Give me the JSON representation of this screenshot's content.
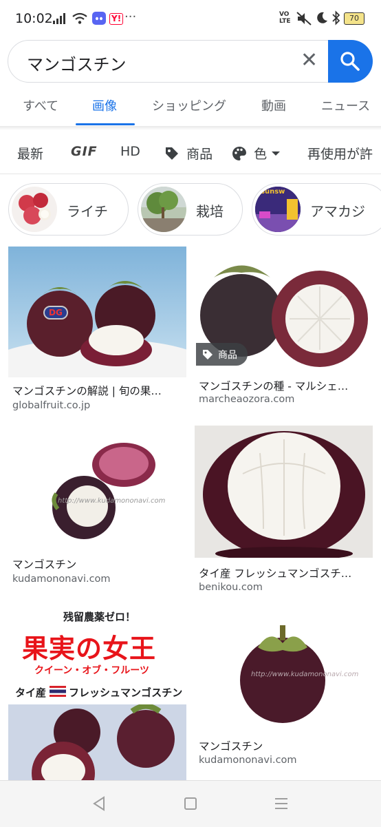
{
  "status_bar": {
    "time": "10:02",
    "signal_label": "Y!",
    "more": "···",
    "volte": "VO LTE",
    "battery": "70"
  },
  "search": {
    "query": "マンゴスチン",
    "clear_label": "✕"
  },
  "tabs": [
    {
      "label": "すべて"
    },
    {
      "label": "画像"
    },
    {
      "label": "ショッピング"
    },
    {
      "label": "動画"
    },
    {
      "label": "ニュース"
    }
  ],
  "filters": {
    "latest": "最新",
    "gif": "GIF",
    "hd": "HD",
    "product": "商品",
    "color": "色",
    "reuse": "再使用が許"
  },
  "chips": [
    {
      "label": "ライチ"
    },
    {
      "label": "栽培"
    },
    {
      "label": "アマカジ"
    }
  ],
  "chip3_thumb_text": "sunsw",
  "results": [
    {
      "title": "マンゴスチンの解説 | 旬の果…",
      "source": "globalfruit.co.jp",
      "badge": "DG"
    },
    {
      "title": "マンゴスチンの種 - マルシェ…",
      "source": "marcheaozora.com",
      "product_badge": "商品"
    },
    {
      "title": "マンゴスチン",
      "source": "kudamononavi.com",
      "watermark": "http://www.kudamononavi.com"
    },
    {
      "title": "タイ産 フレッシュマンゴスチ…",
      "source": "benikou.com"
    },
    {
      "title": "",
      "source": "",
      "poster": {
        "line1": "残留農薬ゼロ！",
        "line2": "果実の女王",
        "line3": "クイーン・オブ・フルーツ",
        "line4": "タイ産",
        "line5": "フレッシュマンゴスチン"
      }
    },
    {
      "title": "マンゴスチン",
      "source": "kudamononavi.com",
      "watermark": "http://www.kudamononavi.com"
    }
  ],
  "colors": {
    "accent": "#1a73e8",
    "poster_red": "#e8141a"
  }
}
